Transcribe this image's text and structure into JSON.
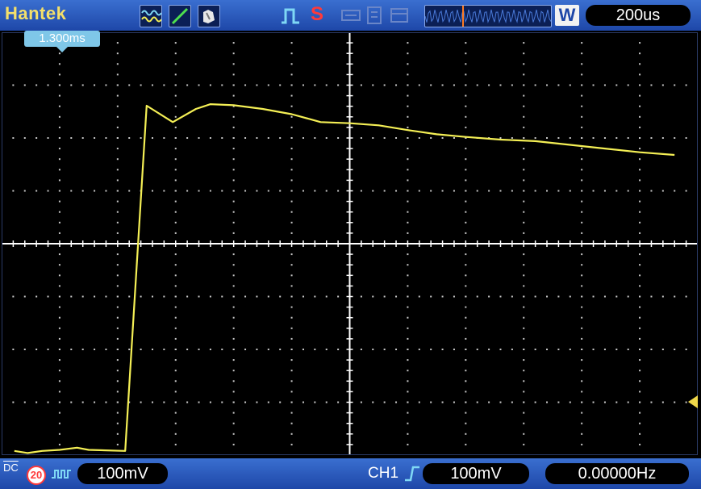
{
  "header": {
    "brand": "Hantek",
    "timebase": "200us",
    "window_mode_label": "W",
    "icons": [
      "waveform-icon",
      "line-display-icon",
      "persistence-icon",
      "pulse-trigger-icon",
      "stop-icon",
      "disabled-icon-1",
      "disabled-icon-2",
      "disabled-icon-3"
    ],
    "stop_label": "S"
  },
  "cursor": {
    "time_label": "1.300ms"
  },
  "footer": {
    "coupling_label": "DC",
    "bw_limit_label": "20",
    "ch1_scale": "100mV",
    "trigger_source": "CH1",
    "trigger_level": "100mV",
    "frequency": "0.00000Hz"
  },
  "colors": {
    "trace": "#f4ef55",
    "bar": "#2a5bc4",
    "grid_dot": "#c8c8c8",
    "axis": "#ffffff"
  },
  "trace": {
    "units": "divisions (x: 0-12 left to right, y: 0-8 top to bottom)",
    "points": [
      [
        0.22,
        7.92
      ],
      [
        0.45,
        7.96
      ],
      [
        0.7,
        7.92
      ],
      [
        1.0,
        7.9
      ],
      [
        1.3,
        7.86
      ],
      [
        1.5,
        7.9
      ],
      [
        2.13,
        7.92
      ],
      [
        2.5,
        1.39
      ],
      [
        2.95,
        1.7
      ],
      [
        3.35,
        1.45
      ],
      [
        3.6,
        1.36
      ],
      [
        4.0,
        1.38
      ],
      [
        4.5,
        1.45
      ],
      [
        5.0,
        1.55
      ],
      [
        5.5,
        1.7
      ],
      [
        6.0,
        1.72
      ],
      [
        6.5,
        1.76
      ],
      [
        7.0,
        1.85
      ],
      [
        7.5,
        1.93
      ],
      [
        8.0,
        1.98
      ],
      [
        8.6,
        2.03
      ],
      [
        9.2,
        2.06
      ],
      [
        9.8,
        2.13
      ],
      [
        10.4,
        2.2
      ],
      [
        11.0,
        2.27
      ],
      [
        11.6,
        2.32
      ]
    ]
  }
}
